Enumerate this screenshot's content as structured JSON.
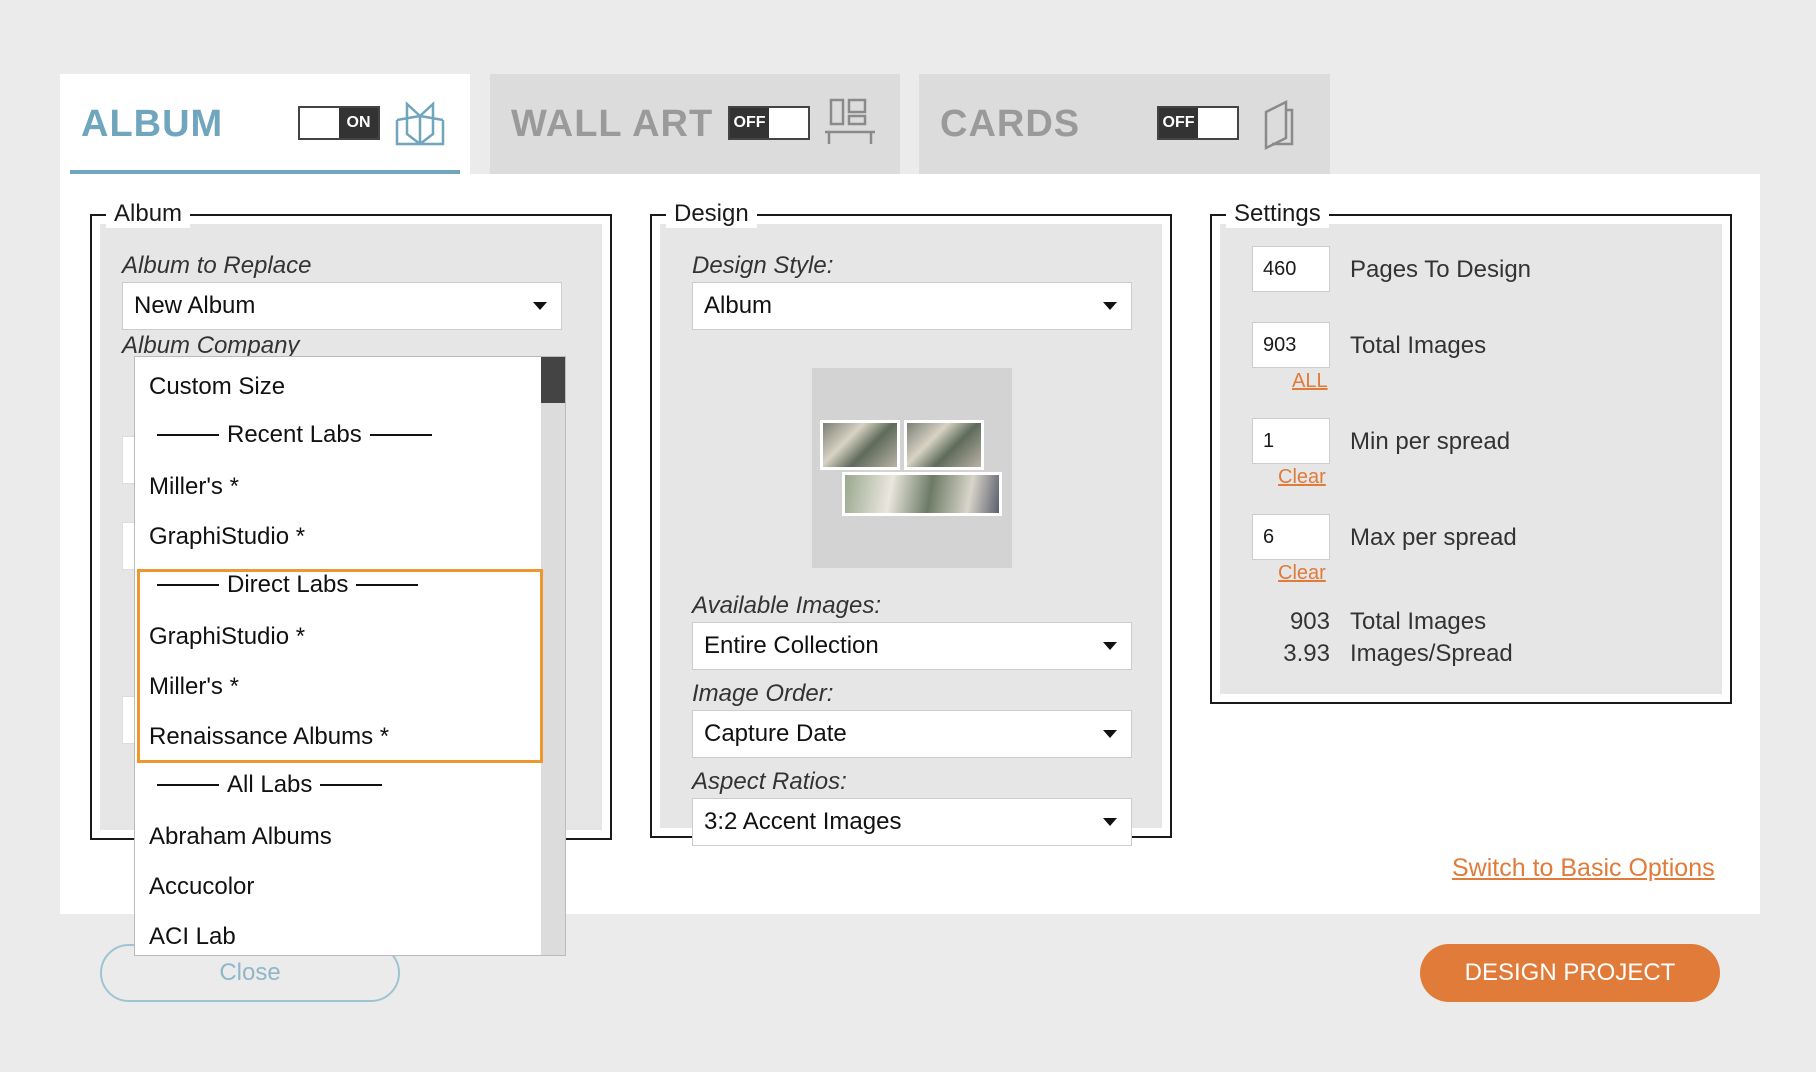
{
  "tabs": [
    {
      "title": "ALBUM",
      "toggle": "ON",
      "icon": "album-book-icon"
    },
    {
      "title": "WALL ART",
      "toggle": "OFF",
      "icon": "wall-art-icon"
    },
    {
      "title": "CARDS",
      "toggle": "OFF",
      "icon": "cards-icon"
    }
  ],
  "album": {
    "legend": "Album",
    "replace_label": "Album to Replace",
    "replace_value": "New Album",
    "company_label": "Album Company"
  },
  "design": {
    "legend": "Design",
    "style_label": "Design Style:",
    "style_value": "Album",
    "available_label": "Available Images:",
    "available_value": "Entire Collection",
    "order_label": "Image Order:",
    "order_value": "Capture Date",
    "aspect_label": "Aspect Ratios:",
    "aspect_value": "3:2 Accent Images"
  },
  "settings": {
    "legend": "Settings",
    "pages_value": "460",
    "pages_label": "Pages To Design",
    "total_value": "903",
    "total_label": "Total Images",
    "all_link": "ALL",
    "min_value": "1",
    "min_label": "Min per spread",
    "min_clear": "Clear",
    "max_value": "6",
    "max_label": "Max per spread",
    "max_clear": "Clear",
    "stat_total_num": "903",
    "stat_total_label": "Total Images",
    "stat_per_num": "3.93",
    "stat_per_label": "Images/Spread"
  },
  "switch_link": "Switch to Basic Options",
  "buttons": {
    "close": "Close",
    "design": "DESIGN PROJECT"
  },
  "dropdown": {
    "custom": "Custom Size",
    "recent_header": "Recent Labs",
    "recent_1": "Miller's *",
    "recent_2": "GraphiStudio *",
    "direct_header": "Direct Labs",
    "direct_1": "GraphiStudio *",
    "direct_2": "Miller's *",
    "direct_3": "Renaissance Albums *",
    "all_header": "All Labs",
    "all_1": "Abraham Albums",
    "all_2": "Accucolor",
    "all_3": "ACI Lab"
  },
  "colors": {
    "accent_blue": "#6fa6bd",
    "accent_orange": "#e07b3a",
    "highlight": "#f0962e"
  }
}
